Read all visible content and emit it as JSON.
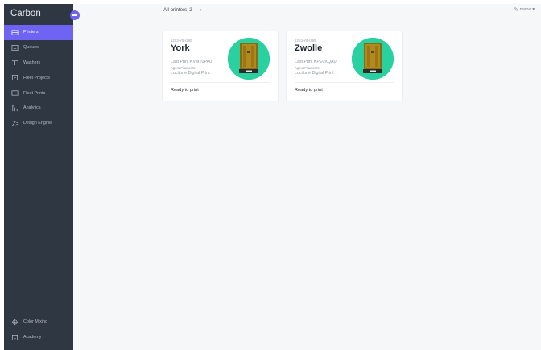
{
  "sidebar": {
    "brand": "Carbon",
    "items": [
      {
        "label": "Printers",
        "icon": "printer-icon",
        "active": true
      },
      {
        "label": "Queues",
        "icon": "queue-icon",
        "active": false
      },
      {
        "label": "Washers",
        "icon": "washer-icon",
        "active": false
      },
      {
        "label": "Fleet Projects",
        "icon": "folder-icon",
        "active": false
      },
      {
        "label": "Fleet Prints",
        "icon": "prints-icon",
        "active": false
      },
      {
        "label": "Analytics",
        "icon": "analytics-icon",
        "active": false
      },
      {
        "label": "Design Engine",
        "icon": "design-engine-icon",
        "active": false
      }
    ],
    "bottom_items": [
      {
        "label": "Color Mixing",
        "icon": "color-mixing-icon"
      },
      {
        "label": "Academy",
        "icon": "academy-icon"
      }
    ]
  },
  "topbar": {
    "filter_label": "All printers",
    "filter_count": "2",
    "sort_label": "By name"
  },
  "printers": [
    {
      "serial": "12S3-Y8H290",
      "name": "York",
      "last_print": "Last Print KVMT0PA0",
      "resin": "Agera Filaments",
      "model": "Lucitone Digital Print",
      "status": "Ready to print"
    },
    {
      "serial": "12S3-Y8H290",
      "name": "Zwolle",
      "last_print": "Last Print KPE0XQA0",
      "resin": "Agera Filaments",
      "model": "Lucitone Digital Print",
      "status": "Ready to print"
    }
  ],
  "colors": {
    "sidebar_bg": "#2f3742",
    "accent": "#6e63f2",
    "avatar_bg": "#29d0a0",
    "page_bg": "#f6f7f9"
  }
}
